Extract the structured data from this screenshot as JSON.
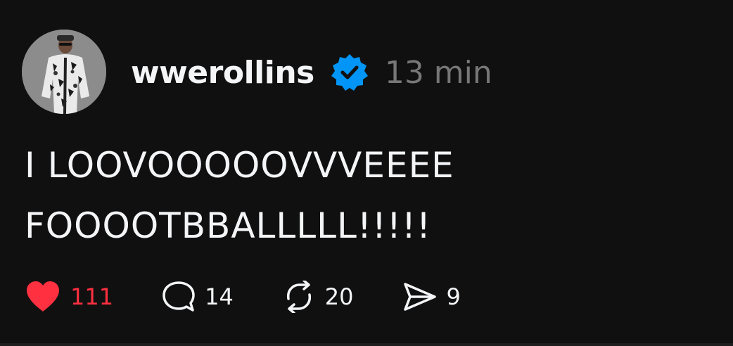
{
  "post": {
    "username": "wwerollins",
    "verified_icon": "verified-badge-icon",
    "timestamp": "13 min",
    "text_line1": "I LOOVOOOOOVVVEEEE",
    "text_line2": "FOOOOTBBALLLLL!!!!!",
    "avatar_icon": "profile-photo"
  },
  "actions": {
    "likes": "111",
    "replies": "14",
    "reposts": "20",
    "shares": "9"
  },
  "colors": {
    "background": "#101010",
    "text": "#f3f5f7",
    "muted": "#777777",
    "like": "#ff3040",
    "verified": "#0095f6"
  }
}
